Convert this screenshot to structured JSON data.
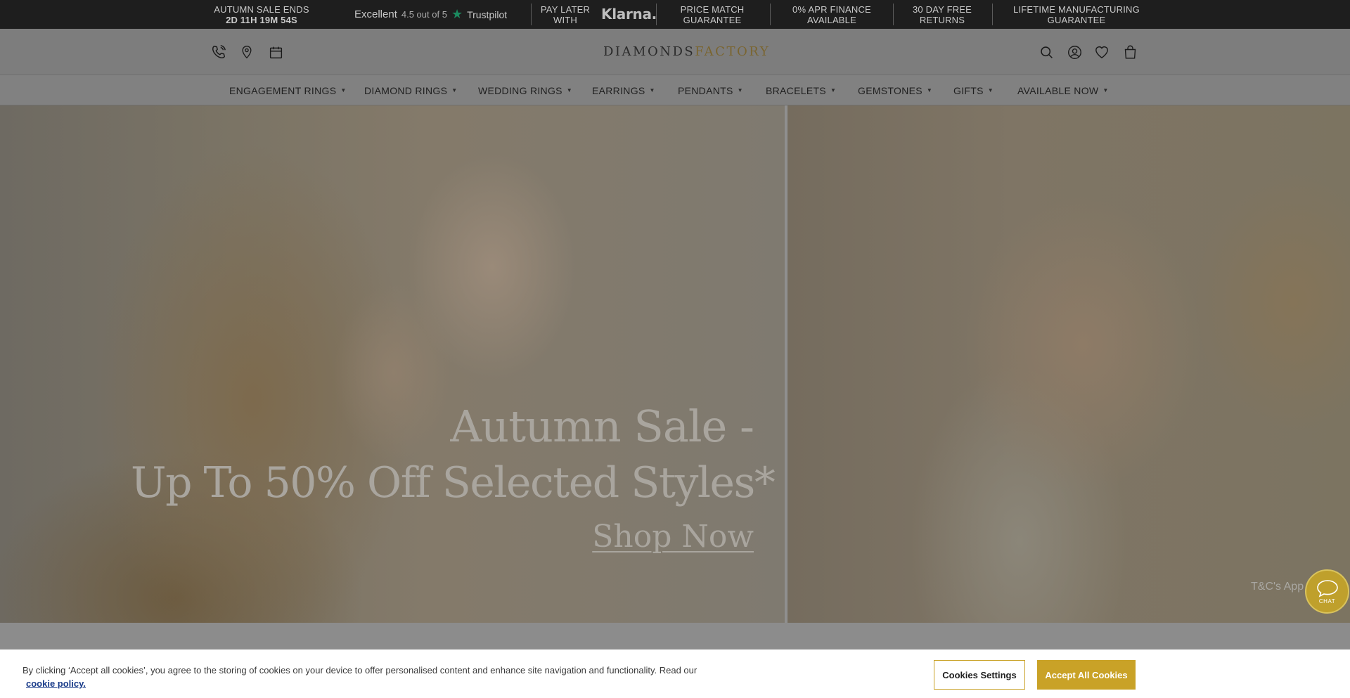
{
  "topbar": {
    "sale_label": "AUTUMN SALE ENDS",
    "sale_countdown": "2D 11H 19M 54S",
    "trustpilot_excellent": "Excellent",
    "trustpilot_score": "4.5 out of 5",
    "trustpilot_brand": "Trustpilot",
    "pay_later_line1": "PAY LATER",
    "pay_later_line2": "WITH",
    "klarna": "Klarna.",
    "price_match_line1": "PRICE MATCH",
    "price_match_line2": "GUARANTEE",
    "apr_line1": "0% APR FINANCE",
    "apr_line2": "AVAILABLE",
    "returns_line1": "30 DAY FREE",
    "returns_line2": "RETURNS",
    "lifetime_line1": "LIFETIME MANUFACTURING",
    "lifetime_line2": "GUARANTEE"
  },
  "header": {
    "logo_part1": "DIAMONDS",
    "logo_part2": "FACTORY",
    "left_icons": [
      "phone-icon",
      "location-pin-icon",
      "calendar-icon"
    ],
    "right_icons": [
      "search-icon",
      "account-icon",
      "heart-icon",
      "bag-icon"
    ]
  },
  "nav": {
    "items": [
      {
        "label": "ENGAGEMENT RINGS"
      },
      {
        "label": "DIAMOND RINGS"
      },
      {
        "label": "WEDDING RINGS"
      },
      {
        "label": "EARRINGS"
      },
      {
        "label": "PENDANTS"
      },
      {
        "label": "BRACELETS"
      },
      {
        "label": "GEMSTONES"
      },
      {
        "label": "GIFTS"
      },
      {
        "label": "AVAILABLE NOW"
      }
    ]
  },
  "hero": {
    "title_line1": "Autumn Sale -",
    "title_line2": "Up To 50% Off Selected Styles*",
    "cta": "Shop Now",
    "tcs": "T&C's App"
  },
  "chat": {
    "label": "CHAT"
  },
  "cookie": {
    "text": "By clicking ‘Accept all cookies’, you agree to the storing of cookies on your device to offer personalised content and enhance site navigation and functionality. Read our",
    "link": "cookie policy.",
    "settings_button": "Cookies Settings",
    "accept_button": "Accept All Cookies"
  },
  "colors": {
    "topbar_bg": "#1e1e1e",
    "accent_gold": "#c9a227",
    "trustpilot_green": "#1b8a5f"
  }
}
